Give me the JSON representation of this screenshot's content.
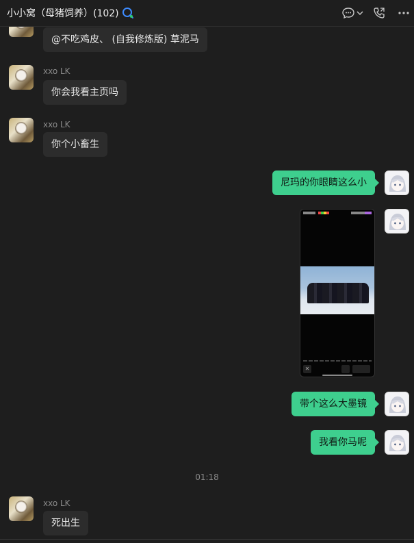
{
  "header": {
    "title": "小小窝（母猪饲养）(102)",
    "icons": [
      "qq-group-icon",
      "chat-bubble-icon",
      "chevron-down-icon",
      "phone-icon",
      "more-icon"
    ]
  },
  "messages": [
    {
      "type": "text",
      "side": "in",
      "text": "@不吃鸡皮、 (自我修炼版) 草泥马"
    },
    {
      "type": "text",
      "side": "in",
      "sender": "xxo LK",
      "text": "你会我看主页吗"
    },
    {
      "type": "text",
      "side": "in",
      "sender": "xxo LK",
      "text": "你个小畜生"
    },
    {
      "type": "text",
      "side": "out",
      "text": "尼玛的你眼睛这么小"
    },
    {
      "type": "image",
      "side": "out",
      "description": "phone-screenshot-image"
    },
    {
      "type": "text",
      "side": "out",
      "text": "带个这么大墨镜"
    },
    {
      "type": "text",
      "side": "out",
      "text": "我看你马呢"
    },
    {
      "type": "time",
      "text": "01:18"
    },
    {
      "type": "text",
      "side": "in",
      "sender": "xxo LK",
      "text": "死出生"
    }
  ],
  "colors": {
    "background": "#1e1e1e",
    "bubble_in": "#2c2c2c",
    "bubble_out": "#3ecf8e",
    "sender": "#8c8c8c"
  }
}
